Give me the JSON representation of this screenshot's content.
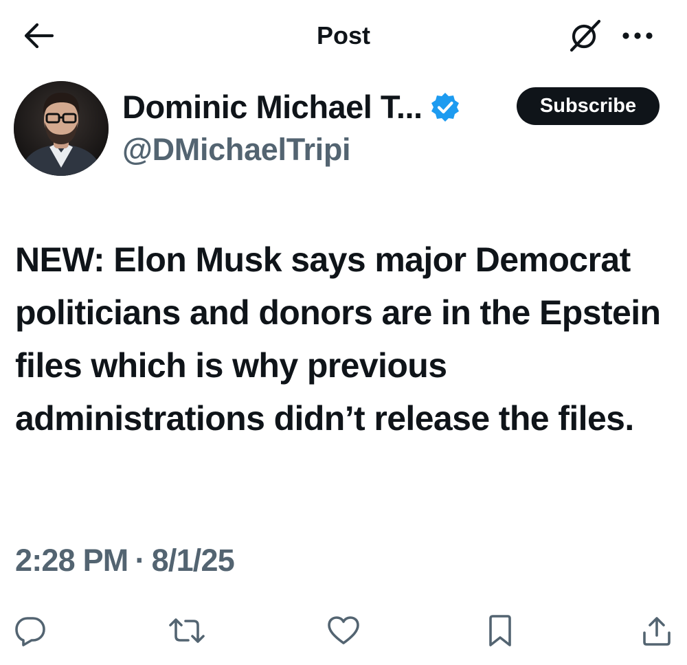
{
  "header": {
    "title": "Post",
    "back_icon": "arrow-left-icon",
    "grok_icon": "grok-icon",
    "more_icon": "more-horizontal-icon"
  },
  "author": {
    "display_name": "Dominic Michael T...",
    "handle": "@DMichaelTripi",
    "verified": true,
    "verified_color": "#1d9bf0",
    "subscribe_label": "Subscribe"
  },
  "post": {
    "text": "NEW: Elon Musk says major Democrat politicians and donors are in the Epstein files which is why previous administrations didn’t release the files.",
    "time": "2:28 PM",
    "separator": "·",
    "date": "8/1/25"
  },
  "actions": [
    {
      "name": "reply",
      "icon": "reply-icon"
    },
    {
      "name": "repost",
      "icon": "repost-icon"
    },
    {
      "name": "like",
      "icon": "heart-icon"
    },
    {
      "name": "bookmark",
      "icon": "bookmark-icon"
    },
    {
      "name": "share",
      "icon": "share-icon"
    }
  ],
  "colors": {
    "text_primary": "#0f1419",
    "text_secondary": "#536471",
    "accent": "#1d9bf0",
    "button_dark": "#0f1419"
  }
}
